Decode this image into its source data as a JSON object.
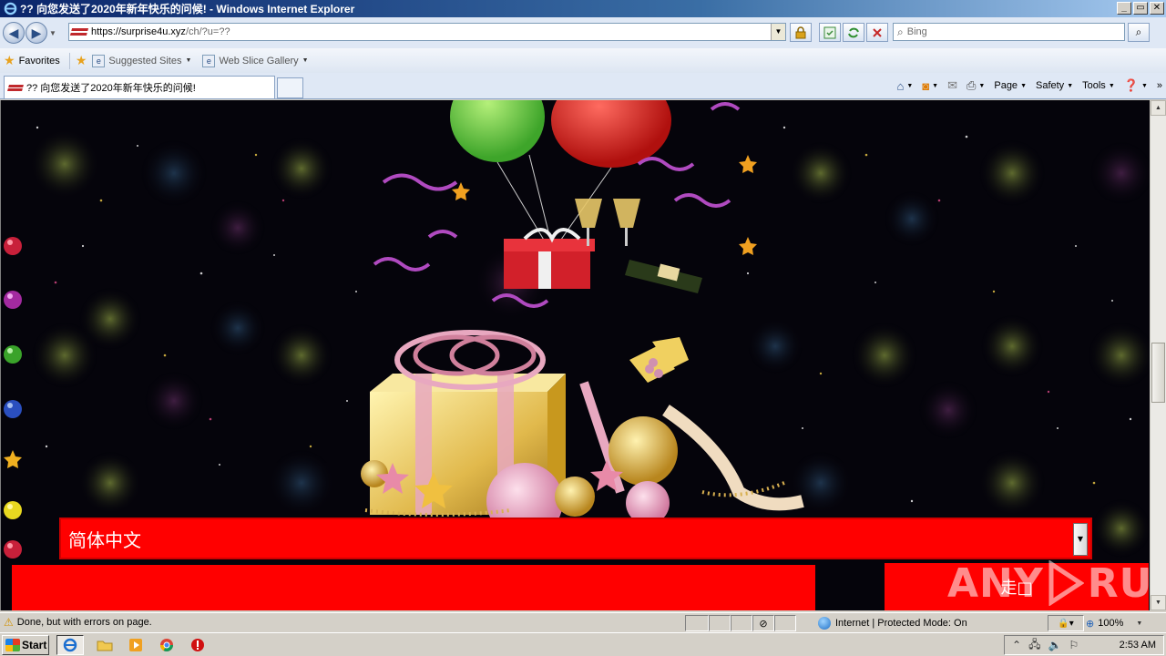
{
  "window": {
    "title": "?? 向您发送了2020年新年快乐的问候! - Windows Internet Explorer",
    "controls": [
      "_",
      "▭",
      "✕"
    ]
  },
  "address_bar": {
    "url_main": "https://surprise4u.xyz",
    "url_path": "/ch/?u=??",
    "search_placeholder": "Bing"
  },
  "favorites_bar": {
    "favorites_label": "Favorites",
    "items": [
      {
        "label": "Suggested Sites"
      },
      {
        "label": "Web Slice Gallery"
      }
    ]
  },
  "tab": {
    "title": "?? 向您发送了2020年新年快乐的问候!"
  },
  "command_bar": {
    "page_label": "Page",
    "safety_label": "Safety",
    "tools_label": "Tools"
  },
  "page": {
    "language_select_value": "简体中文",
    "go_button_label": "走□"
  },
  "watermark": {
    "left": "ANY",
    "right": "RUN"
  },
  "status_bar": {
    "message": "Done, but with errors on page.",
    "zone": "Internet | Protected Mode: On",
    "zoom": "100%"
  },
  "taskbar": {
    "start_label": "Start",
    "clock": "2:53 AM"
  },
  "colors": {
    "page_background": "#05040b",
    "form_red": "#ff0000",
    "titlebar_start": "#0a246a"
  }
}
